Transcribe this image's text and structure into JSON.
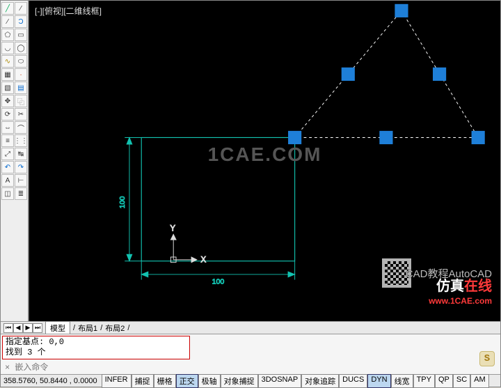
{
  "view_label": "[-][俯视][二维线框]",
  "watermark_center": "1CAE.COM",
  "watermark_brand_cn": "CAD教程AutoCAD",
  "watermark_site_cn": "仿真在线",
  "watermark_site_url": "www.1CAE.com",
  "dimensions": {
    "vertical": "100",
    "horizontal": "100"
  },
  "axes": {
    "x": "X",
    "y": "Y"
  },
  "tabs": {
    "nav": [
      "⏮",
      "◀",
      "▶",
      "⏭"
    ],
    "items": [
      "模型",
      "布局1",
      "布局2"
    ],
    "sep": " / "
  },
  "cmdbox": {
    "line1": "指定基点: 0,0",
    "line2": "找到 3 个"
  },
  "cmd_prompt": "× 嵌入命令",
  "sogou": "S",
  "status": {
    "coords": "358.5760, 50.8440 , 0.0000",
    "toggles": [
      {
        "label": "INFER",
        "on": false
      },
      {
        "label": "捕捉",
        "on": false
      },
      {
        "label": "栅格",
        "on": false
      },
      {
        "label": "正交",
        "on": true
      },
      {
        "label": "极轴",
        "on": false
      },
      {
        "label": "对象捕捉",
        "on": false
      },
      {
        "label": "3DOSNAP",
        "on": false
      },
      {
        "label": "对象追踪",
        "on": false
      },
      {
        "label": "DUCS",
        "on": false
      },
      {
        "label": "DYN",
        "on": true
      },
      {
        "label": "线宽",
        "on": false
      },
      {
        "label": "TPY",
        "on": false
      },
      {
        "label": "QP",
        "on": false
      },
      {
        "label": "SC",
        "on": false
      },
      {
        "label": "AM",
        "on": false
      }
    ]
  }
}
